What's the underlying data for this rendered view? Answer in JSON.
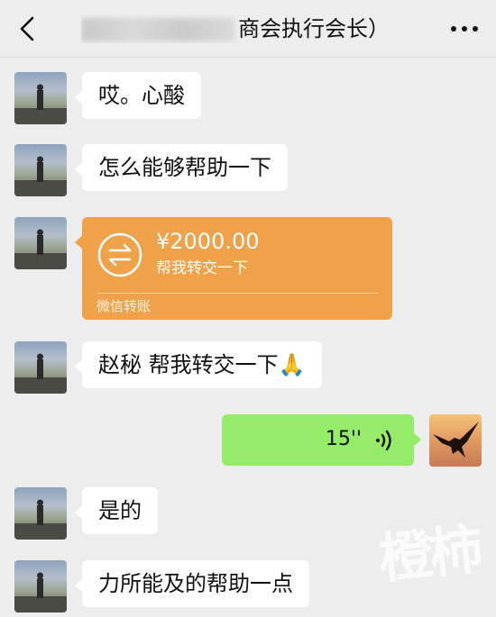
{
  "header": {
    "title_visible": "商会执行会长）"
  },
  "messages": {
    "m1": "哎。心酸",
    "m2": "怎么能够帮助一下",
    "transfer": {
      "amount": "¥2000.00",
      "note": "帮我转交一下",
      "label": "微信转账"
    },
    "m4": "赵秘 帮我转交一下🙏",
    "voice_duration": "15''",
    "m6": "是的",
    "m7": "力所能及的帮助一点"
  },
  "watermark": "橙柿",
  "colors": {
    "background": "#ededed",
    "bubble_in": "#ffffff",
    "bubble_out": "#95ec69",
    "transfer": "#f0a24b"
  },
  "icons": {
    "back": "chevron-left-icon",
    "more": "more-dots-icon",
    "transfer": "transfer-arrows-icon",
    "voice": "voice-wave-icon"
  }
}
